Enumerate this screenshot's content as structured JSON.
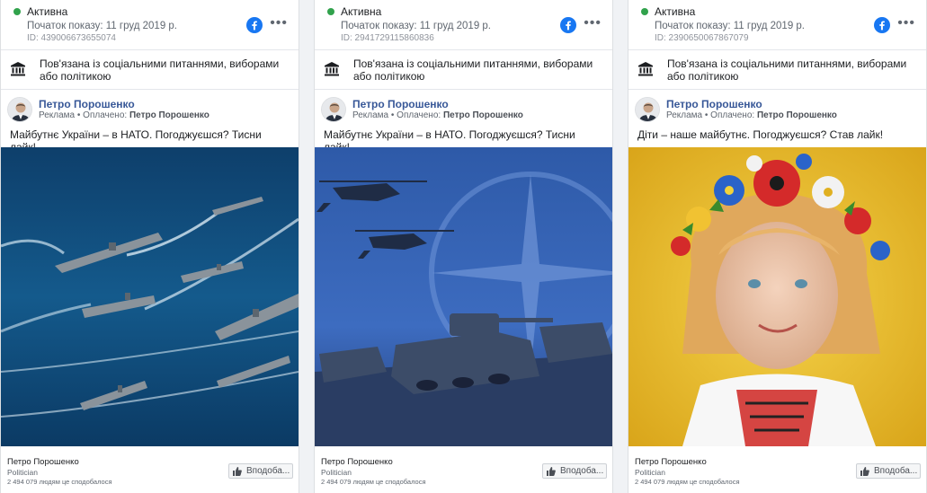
{
  "colors": {
    "active": "#31a24c",
    "link": "#385898",
    "facebook": "#1877f2"
  },
  "cards": [
    {
      "status": "Активна",
      "start": "Початок показу: 11 груд 2019 р.",
      "id": "ID: 439006673655074",
      "political": "Пов'язана із соціальними питаннями, виборами або політикою",
      "page_name": "Петро Порошенко",
      "sponsor_prefix": "Реклама • Оплачено:",
      "sponsor_name": "Петро Порошенко",
      "text": "Майбутнє України – в НАТО. Погоджуєшся? Тисни лайк!",
      "image": "aircraft-carrier-fleet-image",
      "footer_name": "Петро Порошенко",
      "footer_category": "Politician",
      "footer_likes": "2 494 079 людям це сподобалося",
      "like_label": "Вподоба..."
    },
    {
      "status": "Активна",
      "start": "Початок показу: 11 груд 2019 р.",
      "id": "ID: 2941729115860836",
      "political": "Пов'язана із соціальними питаннями, виборами або політикою",
      "page_name": "Петро Порошенко",
      "sponsor_prefix": "Реклама • Оплачено:",
      "sponsor_name": "Петро Порошенко",
      "text": "Майбутнє України – в НАТО. Погоджуєшся? Тисни лайк!",
      "image": "nato-helicopters-tanks-image",
      "footer_name": "Петро Порошенко",
      "footer_category": "Politician",
      "footer_likes": "2 494 079 людям це сподобалося",
      "like_label": "Вподоба..."
    },
    {
      "status": "Активна",
      "start": "Початок показу: 11 груд 2019 р.",
      "id": "ID: 2390650067867079",
      "political": "Пов'язана із соціальними питаннями, виборами або політикою",
      "page_name": "Петро Порошенко",
      "sponsor_prefix": "Реклама • Оплачено:",
      "sponsor_name": "Петро Порошенко",
      "text": "Діти – наше майбутнє. Погоджуєшся? Став лайк!",
      "image": "girl-flower-wreath-image",
      "footer_name": "Петро Порошенко",
      "footer_category": "Politician",
      "footer_likes": "2 494 079 людям це сподобалося",
      "like_label": "Вподоба..."
    }
  ]
}
